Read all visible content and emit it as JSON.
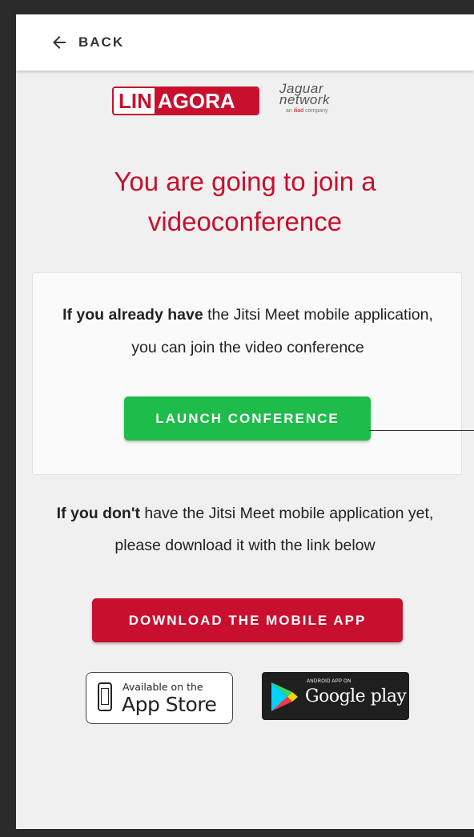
{
  "header": {
    "back_label": "BACK",
    "back_icon": "arrow-left-icon"
  },
  "logos": {
    "linagora_lin": "LIN",
    "linagora_agora": "AGORA",
    "jaguar_line1": "Jaguar",
    "jaguar_line2": "network",
    "jaguar_sub_prefix": "an ",
    "jaguar_sub_brand": "iliad",
    "jaguar_sub_suffix": " company"
  },
  "title": "You are going to join a videoconference",
  "launch_card": {
    "text_bold": "If you already have",
    "text_rest": " the Jitsi Meet mobile application, you can join the video conference",
    "button_label": "LAUNCH CONFERENCE"
  },
  "download_section": {
    "text_bold": "If you don't",
    "text_rest": " have the Jitsi Meet mobile application yet, please download it with the link below",
    "button_label": "DOWNLOAD THE MOBILE APP"
  },
  "stores": {
    "appstore_small": "Available on the",
    "appstore_big": "App Store",
    "google_small": "ANDROID APP ON",
    "google_big": "Google play"
  },
  "colors": {
    "brand_red": "#c8102e",
    "launch_green": "#1ebc4a",
    "background": "#f0f0f0"
  }
}
